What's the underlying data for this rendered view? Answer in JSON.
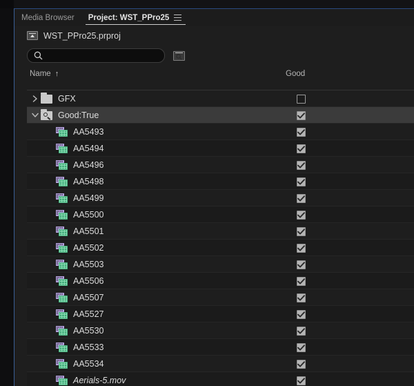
{
  "window": {
    "accent_color": "#3a5f96",
    "panel_bg": "#1e1e1e"
  },
  "tabs": [
    {
      "label": "Media Browser",
      "active": false,
      "name": "tab-media-browser"
    },
    {
      "label": "Project: WST_PPro25",
      "active": true,
      "name": "tab-project"
    }
  ],
  "panel_menu_icon": "hamburger-menu-icon",
  "breadcrumb": {
    "icon": "navigate-up-icon",
    "text": "WST_PPro25.prproj"
  },
  "search": {
    "icon": "search-icon",
    "value": "",
    "placeholder": "",
    "find_button_icon": "find-in-bin-icon"
  },
  "columns": [
    {
      "label": "Name",
      "sort_indicator": "↑",
      "name": "column-header-name"
    },
    {
      "label": "Good",
      "sort_indicator": "",
      "name": "column-header-good"
    }
  ],
  "rows": [
    {
      "label": "GFX",
      "type": "bin",
      "icon": "bin-icon",
      "depth": 0,
      "twisty": "collapsed",
      "good": false,
      "selected": false,
      "italic": false
    },
    {
      "label": "Good:True",
      "type": "search-bin",
      "icon": "search-bin-icon",
      "depth": 0,
      "twisty": "expanded",
      "good": true,
      "selected": true,
      "italic": false
    },
    {
      "label": "AA5493",
      "type": "clip",
      "icon": "video-clip-icon",
      "depth": 1,
      "twisty": "none",
      "good": true,
      "selected": false,
      "italic": false
    },
    {
      "label": "AA5494",
      "type": "clip",
      "icon": "video-clip-icon",
      "depth": 1,
      "twisty": "none",
      "good": true,
      "selected": false,
      "italic": false
    },
    {
      "label": "AA5496",
      "type": "clip",
      "icon": "video-clip-icon",
      "depth": 1,
      "twisty": "none",
      "good": true,
      "selected": false,
      "italic": false
    },
    {
      "label": "AA5498",
      "type": "clip",
      "icon": "video-clip-icon",
      "depth": 1,
      "twisty": "none",
      "good": true,
      "selected": false,
      "italic": false
    },
    {
      "label": "AA5499",
      "type": "clip",
      "icon": "video-clip-icon",
      "depth": 1,
      "twisty": "none",
      "good": true,
      "selected": false,
      "italic": false
    },
    {
      "label": "AA5500",
      "type": "clip",
      "icon": "video-clip-icon",
      "depth": 1,
      "twisty": "none",
      "good": true,
      "selected": false,
      "italic": false
    },
    {
      "label": "AA5501",
      "type": "clip",
      "icon": "video-clip-icon",
      "depth": 1,
      "twisty": "none",
      "good": true,
      "selected": false,
      "italic": false
    },
    {
      "label": "AA5502",
      "type": "clip",
      "icon": "video-clip-icon",
      "depth": 1,
      "twisty": "none",
      "good": true,
      "selected": false,
      "italic": false
    },
    {
      "label": "AA5503",
      "type": "clip",
      "icon": "video-clip-icon",
      "depth": 1,
      "twisty": "none",
      "good": true,
      "selected": false,
      "italic": false
    },
    {
      "label": "AA5506",
      "type": "clip",
      "icon": "video-clip-icon",
      "depth": 1,
      "twisty": "none",
      "good": true,
      "selected": false,
      "italic": false
    },
    {
      "label": "AA5507",
      "type": "clip",
      "icon": "video-clip-icon",
      "depth": 1,
      "twisty": "none",
      "good": true,
      "selected": false,
      "italic": false
    },
    {
      "label": "AA5527",
      "type": "clip",
      "icon": "video-clip-icon",
      "depth": 1,
      "twisty": "none",
      "good": true,
      "selected": false,
      "italic": false
    },
    {
      "label": "AA5530",
      "type": "clip",
      "icon": "video-clip-icon",
      "depth": 1,
      "twisty": "none",
      "good": true,
      "selected": false,
      "italic": false
    },
    {
      "label": "AA5533",
      "type": "clip",
      "icon": "video-clip-icon",
      "depth": 1,
      "twisty": "none",
      "good": true,
      "selected": false,
      "italic": false
    },
    {
      "label": "AA5534",
      "type": "clip",
      "icon": "video-clip-icon",
      "depth": 1,
      "twisty": "none",
      "good": true,
      "selected": false,
      "italic": false
    },
    {
      "label": "Aerials-5.mov",
      "type": "clip",
      "icon": "video-clip-icon",
      "depth": 1,
      "twisty": "none",
      "good": true,
      "selected": false,
      "italic": true
    }
  ]
}
